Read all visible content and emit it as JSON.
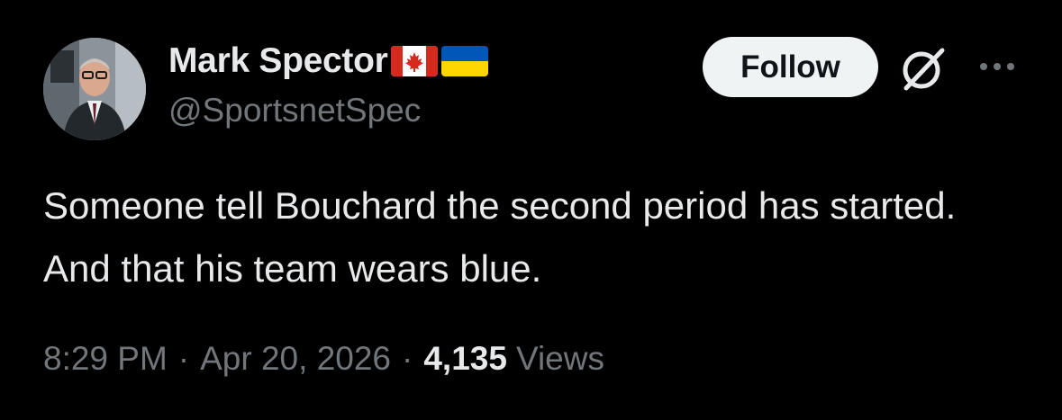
{
  "tweet": {
    "author": {
      "display_name": "Mark Spector",
      "handle": "@SportsnetSpec",
      "avatar": "profile-photo",
      "flags": [
        "canada-flag-icon",
        "ukraine-flag-icon"
      ]
    },
    "follow_label": "Follow",
    "grok_icon": "grok-icon",
    "more_icon": "more-icon",
    "text": "Someone tell Bouchard the second period has started. And that his team wears blue.",
    "meta": {
      "time": "8:29 PM",
      "separator": "·",
      "date": "Apr 20, 2026",
      "views_count": "4,135",
      "views_label": "Views"
    }
  },
  "colors": {
    "background": "#000000",
    "primary_text": "#e7e9ea",
    "secondary_text": "#71767b",
    "follow_bg": "#eff3f4",
    "follow_text": "#0f1419"
  }
}
